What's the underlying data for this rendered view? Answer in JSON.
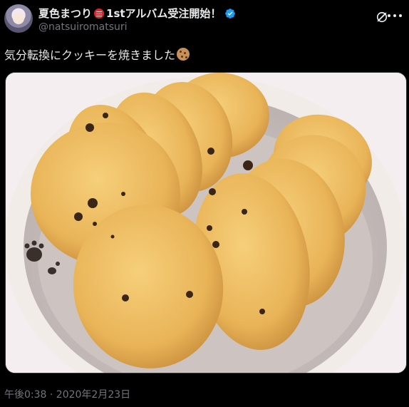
{
  "account": {
    "display_name_prefix": "夏色まつり",
    "display_name_suffix": "1stアルバム受注開始！",
    "handle": "@natsuiromatsuri",
    "verified_icon": "verified-badge-icon",
    "badge_icon": "red-flag-emoji-icon",
    "avatar_icon": "profile-avatar"
  },
  "header_actions": {
    "grok_icon": "grok-icon",
    "more_icon": "more-options-icon"
  },
  "tweet": {
    "text": "気分転換にクッキーを焼きました",
    "emoji_icon": "cookie-emoji-icon",
    "timestamp": "午後0:38 · 2020年2月23日"
  },
  "media": {
    "type": "photo",
    "subject": "cookie-bowl-photo"
  },
  "colors": {
    "background": "#000000",
    "primary_text": "#e7e9ea",
    "secondary_text": "#71767b",
    "verified_blue": "#1d9bf0"
  }
}
